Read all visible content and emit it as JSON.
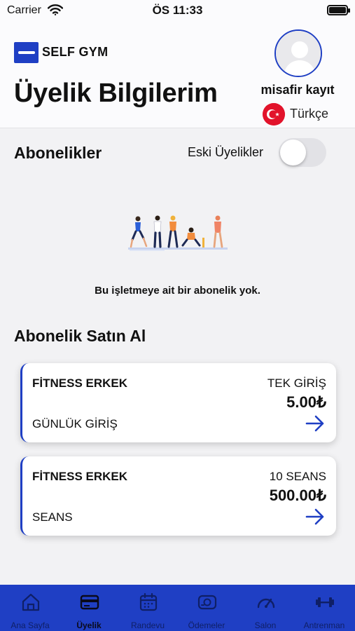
{
  "status_bar": {
    "carrier": "Carrier",
    "time": "ÖS 11:33"
  },
  "header": {
    "brand": "SELF GYM",
    "title": "Üyelik Bilgilerim",
    "user_name": "misafir kayıt",
    "language": "Türkçe"
  },
  "subscriptions": {
    "title": "Abonelikler",
    "old_memberships_label": "Eski Üyelikler",
    "old_memberships_on": false,
    "empty_message": "Bu işletmeye ait bir abonelik yok."
  },
  "purchase": {
    "title": "Abonelik Satın Al",
    "cards": [
      {
        "name": "FİTNESS ERKEK",
        "type": "TEK GİRİŞ",
        "price": "5.00₺",
        "subtitle": "GÜNLÜK GİRİŞ"
      },
      {
        "name": "FİTNESS ERKEK",
        "type": "10 SEANS",
        "price": "500.00₺",
        "subtitle": "SEANS"
      }
    ]
  },
  "tabbar": {
    "active": "Üyelik",
    "items": [
      {
        "label": "Ana Sayfa",
        "icon": "home-icon"
      },
      {
        "label": "Üyelik",
        "icon": "card-icon"
      },
      {
        "label": "Randevu",
        "icon": "calendar-icon"
      },
      {
        "label": "Ödemeler",
        "icon": "payment-icon"
      },
      {
        "label": "Salon",
        "icon": "speedometer-icon"
      },
      {
        "label": "Antrenman",
        "icon": "dumbbell-icon"
      }
    ]
  },
  "colors": {
    "accent": "#1f3fc4",
    "background": "#f2f2f4",
    "flag_red": "#e2132b"
  }
}
